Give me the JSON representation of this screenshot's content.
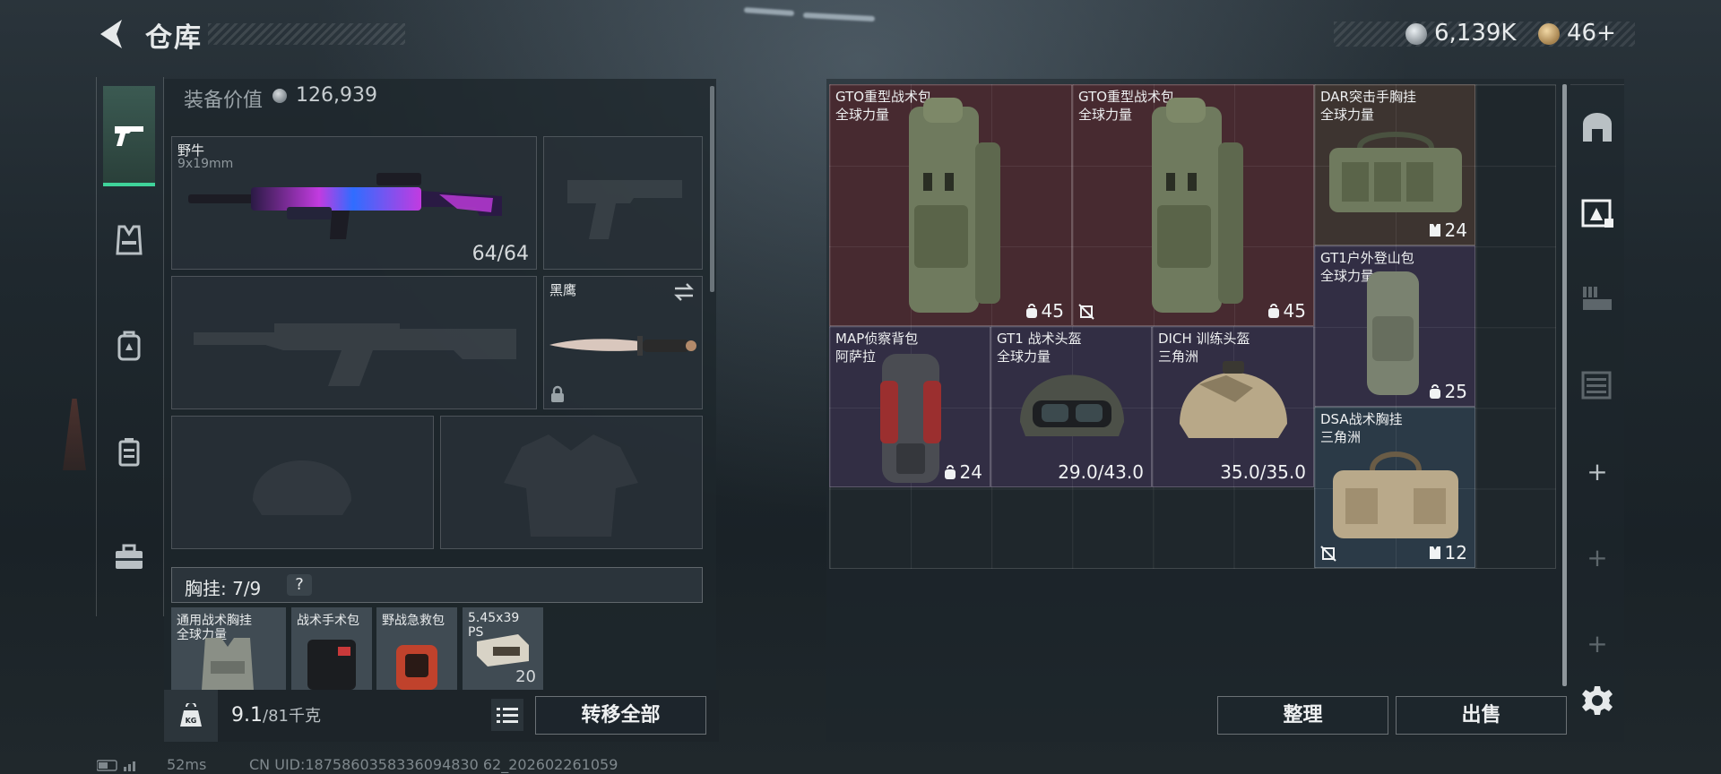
{
  "header": {
    "title": "仓库"
  },
  "currencies": [
    {
      "icon": "silver-coin-icon",
      "value": "6,139K"
    },
    {
      "icon": "gold-coin-icon",
      "value": "46+"
    }
  ],
  "equipment": {
    "label": "装备价值",
    "value": "126,939",
    "primary_weapon": {
      "name": "野牛",
      "caliber": "9x19mm",
      "ammo": "64/64"
    },
    "melee": {
      "name": "黑鹰"
    }
  },
  "chest_rig": {
    "label": "胸挂: 7/9",
    "help": "?",
    "items": [
      {
        "name": "通用战术胸挂",
        "sub": "全球力量"
      },
      {
        "name": "战术手术包",
        "sub": ""
      },
      {
        "name": "野战急救包",
        "sub": ""
      },
      {
        "name": "5.45x39",
        "sub": "PS",
        "count": "20"
      }
    ]
  },
  "bottom": {
    "weight": "9.1",
    "weight_cap": "/81千克",
    "transfer_all": "转移全部"
  },
  "status": {
    "ping": "52ms",
    "uid": "CN UID:1875860358336094830 62_202602261059"
  },
  "warehouse": {
    "items": [
      {
        "name": "GTO重型战术包",
        "sub": "全球力量",
        "stat": "45",
        "stat_icon": "capacity-icon"
      },
      {
        "name": "GTO重型战术包",
        "sub": "全球力量",
        "stat": "45",
        "stat_icon": "capacity-icon"
      },
      {
        "name": "DAR突击手胸挂",
        "sub": "全球力量",
        "stat": "24",
        "stat_icon": "vest-capacity-icon"
      },
      {
        "name": "GT1户外登山包",
        "sub": "全球力量",
        "stat": "25",
        "stat_icon": "capacity-icon"
      },
      {
        "name": "MAP侦察背包",
        "sub": "阿萨拉",
        "stat": "24",
        "stat_icon": "capacity-icon"
      },
      {
        "name": "GT1 战术头盔",
        "sub": "全球力量",
        "stat": "29.0/43.0"
      },
      {
        "name": "DICH 训练头盔",
        "sub": "三角洲",
        "stat": "35.0/35.0"
      },
      {
        "name": "DSA战术胸挂",
        "sub": "三角洲",
        "stat": "12",
        "stat_icon": "vest-capacity-icon"
      }
    ],
    "sort_button": "整理",
    "sell_button": "出售"
  },
  "colors": {
    "accent_green": "#3fd39a",
    "rarity_red": "#472a30",
    "rarity_purple": "#322e44",
    "rarity_blue": "#2b3a47"
  }
}
